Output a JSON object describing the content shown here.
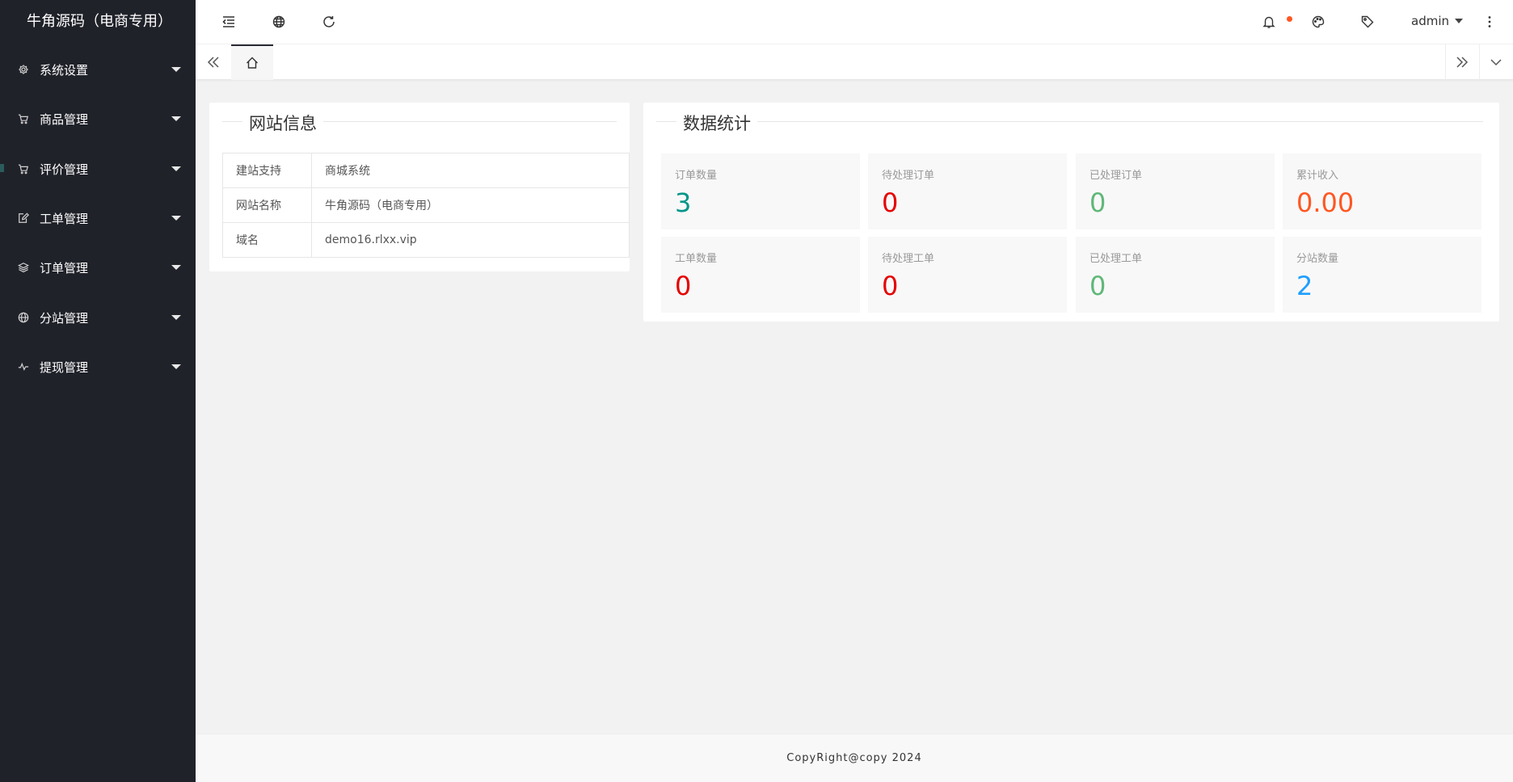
{
  "app": {
    "title": "牛角源码（电商专用）"
  },
  "sidebar": {
    "items": [
      {
        "label": "系统设置",
        "icon": "gear-icon"
      },
      {
        "label": "商品管理",
        "icon": "cart-icon"
      },
      {
        "label": "评价管理",
        "icon": "cart-icon"
      },
      {
        "label": "工单管理",
        "icon": "edit-icon"
      },
      {
        "label": "订单管理",
        "icon": "layers-icon"
      },
      {
        "label": "分站管理",
        "icon": "globe-icon"
      },
      {
        "label": "提现管理",
        "icon": "pulse-icon"
      }
    ]
  },
  "header": {
    "user": "admin"
  },
  "site_info": {
    "title": "网站信息",
    "rows": [
      {
        "key": "建站支持",
        "value": "商城系统"
      },
      {
        "key": "网站名称",
        "value": "牛角源码（电商专用）"
      },
      {
        "key": "域名",
        "value": "demo16.rlxx.vip"
      }
    ]
  },
  "stats": {
    "title": "数据统计",
    "items": [
      {
        "label": "订单数量",
        "value": "3",
        "color": "#009688"
      },
      {
        "label": "待处理订单",
        "value": "0",
        "color": "#e60000"
      },
      {
        "label": "已处理订单",
        "value": "0",
        "color": "#5fb878"
      },
      {
        "label": "累计收入",
        "value": "0.00",
        "color": "#ff5722"
      },
      {
        "label": "工单数量",
        "value": "0",
        "color": "#e60000"
      },
      {
        "label": "待处理工单",
        "value": "0",
        "color": "#e60000"
      },
      {
        "label": "已处理工单",
        "value": "0",
        "color": "#5fb878"
      },
      {
        "label": "分站数量",
        "value": "2",
        "color": "#1e9fff"
      }
    ]
  },
  "footer": {
    "text": "CopyRight@copy 2024"
  }
}
